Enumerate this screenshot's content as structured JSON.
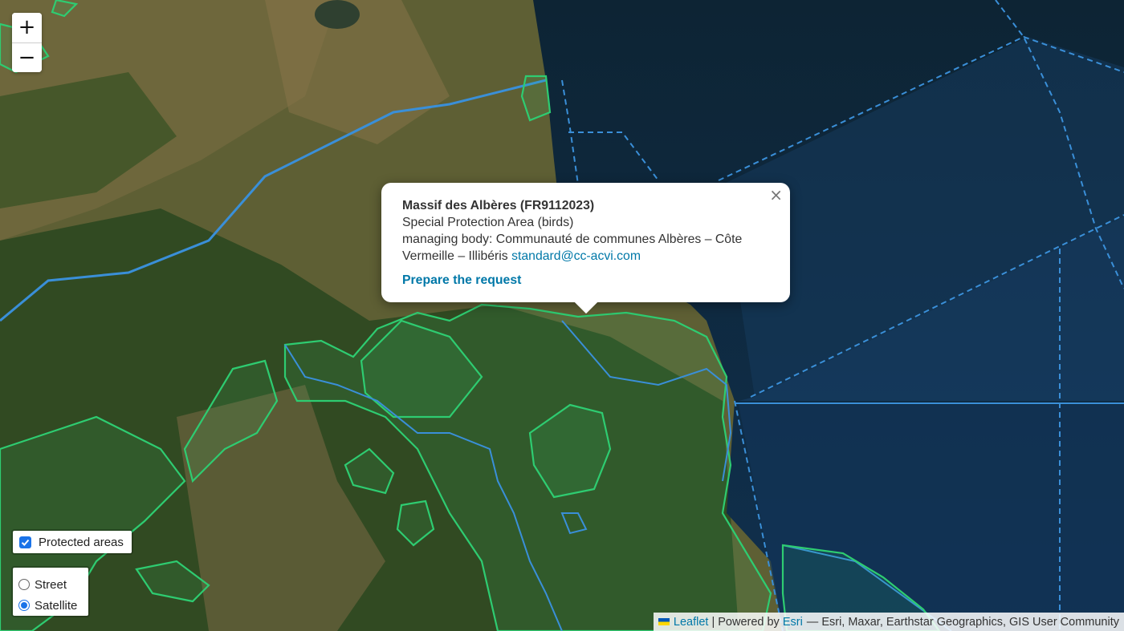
{
  "map": {
    "zoom_in_label": "+",
    "zoom_out_label": "−"
  },
  "layers": {
    "overlay_label": "Protected areas",
    "overlay_checked": true,
    "base_options": [
      {
        "label": "Street",
        "selected": false
      },
      {
        "label": "Satellite",
        "selected": true
      }
    ]
  },
  "popup": {
    "close_label": "×",
    "title": "Massif des Albères (FR9112023)",
    "type": "Special Protection Area (birds)",
    "managing_body": "managing body: Communauté de communes Albères – Côte Vermeille – Illibéris",
    "email": "standard@cc-acvi.com",
    "action_label": "Prepare the request"
  },
  "attribution": {
    "leaflet": "Leaflet",
    "separator": "|",
    "powered_by": "Powered by",
    "esri": "Esri",
    "sources": "— Esri, Maxar, Earthstar Geographics, GIS User Community"
  },
  "colors": {
    "sea": "#0f2a45",
    "land": "#4f5a2c",
    "protected_outline": "#2ecc71",
    "marine_outline": "#3a8fd8",
    "link": "#0078a8"
  }
}
